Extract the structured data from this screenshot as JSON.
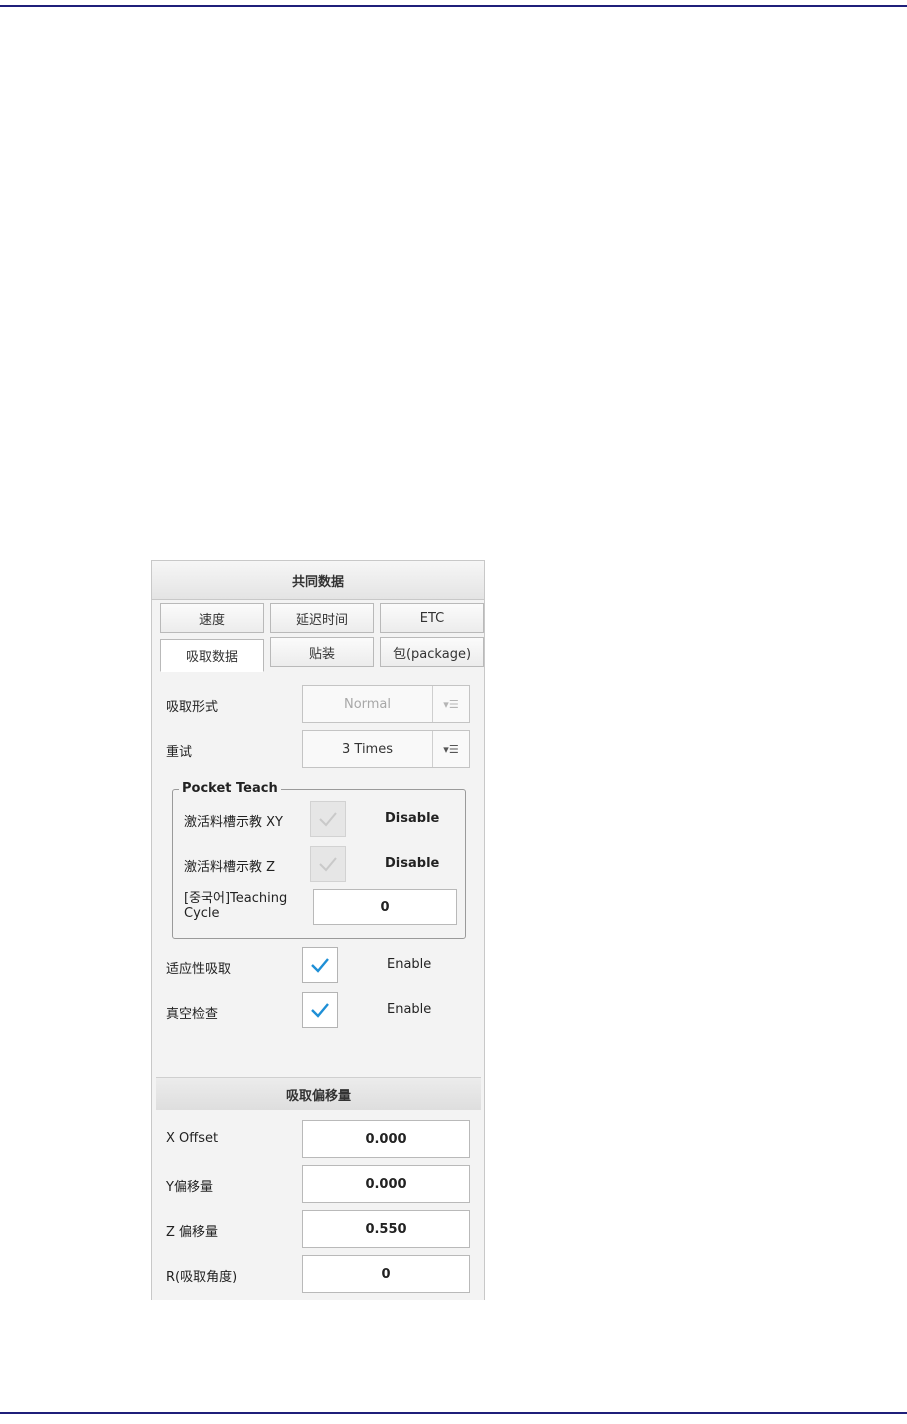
{
  "panel": {
    "title": "共同数据",
    "tabs": [
      {
        "label": "速度"
      },
      {
        "label": "延迟时间"
      },
      {
        "label": "ETC"
      },
      {
        "label": "吸取数据"
      },
      {
        "label": "贴装"
      },
      {
        "label": "包(package)"
      }
    ],
    "active_tab": "吸取数据"
  },
  "pickup_type": {
    "label": "吸取形式",
    "value": "Normal",
    "enabled": false
  },
  "retry": {
    "label": "重试",
    "value": "3 Times",
    "enabled": true
  },
  "pocket_teach": {
    "title": "Pocket Teach",
    "activate_xy": {
      "label": "激活料槽示教 XY",
      "checked": false,
      "state": "Disable"
    },
    "activate_z": {
      "label": "激活料槽示教 Z",
      "checked": false,
      "state": "Disable"
    },
    "teaching_cycle": {
      "label_line1": "[중국어]Teaching",
      "label_line2": "Cycle",
      "value": "0"
    }
  },
  "adaptive_pickup": {
    "label": "适应性吸取",
    "checked": true,
    "state": "Enable"
  },
  "vacuum_check": {
    "label": "真空检查",
    "checked": true,
    "state": "Enable"
  },
  "offset_section": {
    "title": "吸取偏移量"
  },
  "offsets": {
    "x": {
      "label": "X Offset",
      "value": "0.000"
    },
    "y": {
      "label": "Y偏移量",
      "value": "0.000"
    },
    "z": {
      "label": "Z 偏移量",
      "value": "0.550"
    },
    "r": {
      "label": "R(吸取角度)",
      "value": "0"
    }
  },
  "colors": {
    "accent_check": "#1e8fd6",
    "page_rule": "#1f1f7a"
  },
  "icons": {
    "dropdown": "dropdown-list-icon",
    "check": "checkmark-icon"
  }
}
